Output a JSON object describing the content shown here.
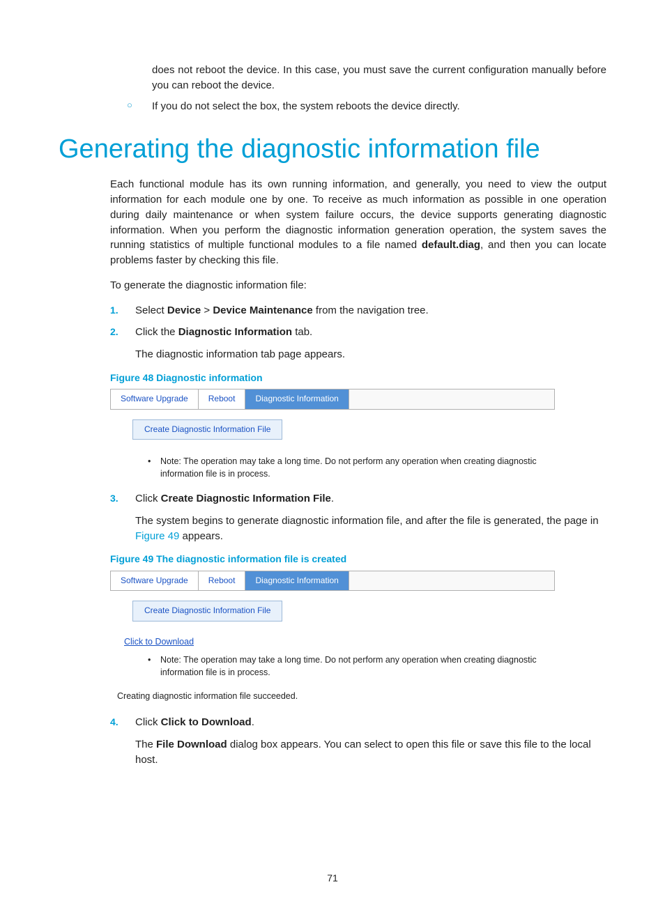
{
  "intro": {
    "cont": "does not reboot the device. In this case, you must save the current configuration manually before you can reboot the device.",
    "bullet2": "If you do not select the box, the system reboots the device directly."
  },
  "heading": "Generating the diagnostic information file",
  "para1_a": "Each functional module has its own running information, and generally, you need to view the output information for each module one by one. To receive as much information as possible in one operation during daily maintenance or when system failure occurs, the device supports generating diagnostic information. When you perform the diagnostic information generation operation, the system saves the running statistics of multiple functional modules to a file named ",
  "para1_bold": "default.diag",
  "para1_b": ", and then you can locate problems faster by checking this file.",
  "para2": "To generate the diagnostic information file:",
  "steps": {
    "s1_a": "Select ",
    "s1_b1": "Device",
    "s1_mid": " > ",
    "s1_b2": "Device Maintenance",
    "s1_c": " from the navigation tree.",
    "s2_a": "Click the ",
    "s2_b": "Diagnostic Information",
    "s2_c": " tab.",
    "s2_sub": "The diagnostic information tab page appears.",
    "s3_a": "Click ",
    "s3_b": "Create Diagnostic Information File",
    "s3_c": ".",
    "s3_sub_a": "The system begins to generate diagnostic information file, and after the file is generated, the page in ",
    "s3_sub_ref": "Figure 49",
    "s3_sub_b": " appears.",
    "s4_a": "Click ",
    "s4_b": "Click to Download",
    "s4_c": ".",
    "s4_sub_a": "The ",
    "s4_sub_b": "File Download",
    "s4_sub_c": " dialog box appears. You can select to open this file or save this file to the local host."
  },
  "fig48": {
    "caption": "Figure 48 Diagnostic information",
    "tab1": "Software Upgrade",
    "tab2": "Reboot",
    "tab3": "Diagnostic Information",
    "button": "Create Diagnostic Information File",
    "note": "Note: The operation may take a long time. Do not perform any operation when creating diagnostic information file is in process."
  },
  "fig49": {
    "caption": "Figure 49 The diagnostic information file is created",
    "tab1": "Software Upgrade",
    "tab2": "Reboot",
    "tab3": "Diagnostic Information",
    "button": "Create Diagnostic Information File",
    "download": "Click to Download",
    "note": "Note: The operation may take a long time. Do not perform any operation when creating diagnostic information file is in process.",
    "success": "Creating diagnostic information file succeeded."
  },
  "page_number": "71"
}
